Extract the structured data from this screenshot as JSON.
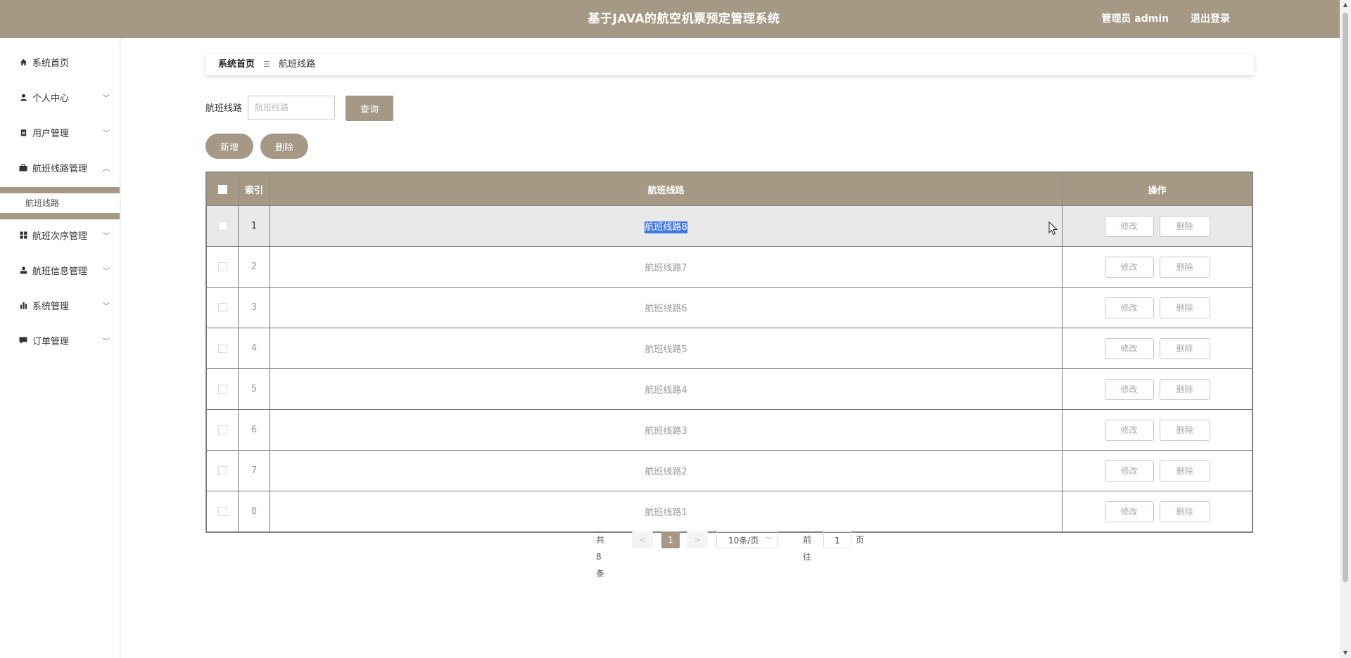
{
  "app": {
    "title": "基于JAVA的航空机票预定管理系统",
    "user": "管理员 admin",
    "logout": "退出登录"
  },
  "sidebar": {
    "items": [
      {
        "label": "系统首页",
        "icon": "home-icon"
      },
      {
        "label": "个人中心",
        "icon": "user-icon"
      },
      {
        "label": "用户管理",
        "icon": "clipboard-icon"
      },
      {
        "label": "航班线路管理",
        "icon": "briefcase-icon"
      },
      {
        "label": "航班次序管理",
        "icon": "grid-icon"
      },
      {
        "label": "航班信息管理",
        "icon": "person-icon"
      },
      {
        "label": "系统管理",
        "icon": "bar-chart-icon"
      },
      {
        "label": "订单管理",
        "icon": "comment-icon"
      }
    ],
    "sub_item": "航班线路"
  },
  "breadcrumb": {
    "home": "系统首页",
    "current": "航班线路"
  },
  "search": {
    "label": "航班线路",
    "placeholder": "航班线路",
    "button": "查询"
  },
  "actions": {
    "add": "新增",
    "delete": "删除"
  },
  "table": {
    "headers": [
      "索引",
      "航班线路",
      "操作"
    ],
    "rows": [
      {
        "index": "1",
        "route": "航班线路8"
      },
      {
        "index": "2",
        "route": "航班线路7"
      },
      {
        "index": "3",
        "route": "航班线路6"
      },
      {
        "index": "4",
        "route": "航班线路5"
      },
      {
        "index": "5",
        "route": "航班线路4"
      },
      {
        "index": "6",
        "route": "航班线路3"
      },
      {
        "index": "7",
        "route": "航班线路2"
      },
      {
        "index": "8",
        "route": "航班线路1"
      }
    ],
    "edit_label": "修改",
    "delete_label": "删除"
  },
  "pagination": {
    "total": "共 8 条",
    "prev": "<",
    "next": ">",
    "current": "1",
    "page_size": "10条/页",
    "goto_prefix": "前往",
    "goto_value": "1",
    "goto_suffix": "页"
  },
  "colors": {
    "accent": "#a59986",
    "selection": "#3b78e7"
  }
}
